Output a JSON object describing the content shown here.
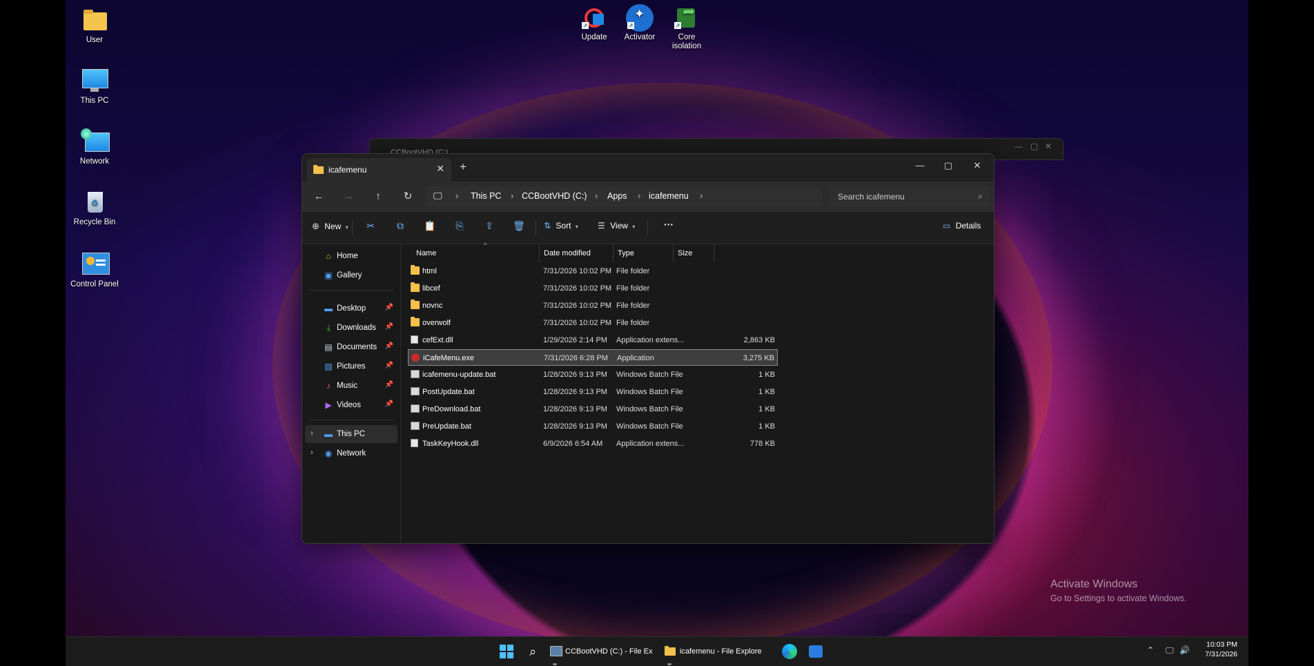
{
  "desktop": {
    "icons": [
      {
        "label": "User"
      },
      {
        "label": "This PC"
      },
      {
        "label": "Network"
      },
      {
        "label": "Recycle Bin"
      },
      {
        "label": "Control Panel"
      },
      {
        "label": "Update"
      },
      {
        "label": "Activator"
      },
      {
        "label": "Core isolation"
      }
    ]
  },
  "back_window": {
    "tab_label": "CCBootVHD (C:)"
  },
  "window": {
    "tab_label": "icafemenu",
    "address": [
      "This PC",
      "CCBootVHD (C:)",
      "Apps",
      "icafemenu"
    ],
    "search_placeholder": "Search icafemenu",
    "toolbar": {
      "new": "New",
      "sort": "Sort",
      "view": "View",
      "more": "···",
      "details": "Details"
    },
    "sidebar": {
      "quick": [
        {
          "label": "Home"
        },
        {
          "label": "Gallery"
        }
      ],
      "pinned": [
        {
          "label": "Desktop"
        },
        {
          "label": "Downloads"
        },
        {
          "label": "Documents"
        },
        {
          "label": "Pictures"
        },
        {
          "label": "Music"
        },
        {
          "label": "Videos"
        }
      ],
      "tree": [
        {
          "label": "This PC"
        },
        {
          "label": "Network"
        }
      ]
    },
    "columns": {
      "name": "Name",
      "date": "Date modified",
      "type": "Type",
      "size": "Size"
    },
    "files": [
      {
        "name": "html",
        "date": "7/31/2026 10:02 PM",
        "type": "File folder",
        "size": "",
        "icon": "folder"
      },
      {
        "name": "libcef",
        "date": "7/31/2026 10:02 PM",
        "type": "File folder",
        "size": "",
        "icon": "folder"
      },
      {
        "name": "novnc",
        "date": "7/31/2026 10:02 PM",
        "type": "File folder",
        "size": "",
        "icon": "folder"
      },
      {
        "name": "overwolf",
        "date": "7/31/2026 10:02 PM",
        "type": "File folder",
        "size": "",
        "icon": "folder"
      },
      {
        "name": "cefExt.dll",
        "date": "1/29/2026 2:14 PM",
        "type": "Application extens...",
        "size": "2,863 KB",
        "icon": "doc"
      },
      {
        "name": "iCafeMenu.exe",
        "date": "7/31/2026 6:28 PM",
        "type": "Application",
        "size": "3,275 KB",
        "icon": "exe"
      },
      {
        "name": "icafemenu-update.bat",
        "date": "1/28/2026 9:13 PM",
        "type": "Windows Batch File",
        "size": "1 KB",
        "icon": "bat"
      },
      {
        "name": "PostUpdate.bat",
        "date": "1/28/2026 9:13 PM",
        "type": "Windows Batch File",
        "size": "1 KB",
        "icon": "bat"
      },
      {
        "name": "PreDownload.bat",
        "date": "1/28/2026 9:13 PM",
        "type": "Windows Batch File",
        "size": "1 KB",
        "icon": "bat"
      },
      {
        "name": "PreUpdate.bat",
        "date": "1/28/2026 9:13 PM",
        "type": "Windows Batch File",
        "size": "1 KB",
        "icon": "bat"
      },
      {
        "name": "TaskKeyHook.dll",
        "date": "6/9/2026 6:54 AM",
        "type": "Application extens...",
        "size": "778 KB",
        "icon": "doc"
      }
    ]
  },
  "watermark": {
    "line1": "Activate Windows",
    "line2": "Go to Settings to activate Windows."
  },
  "taskbar": {
    "apps": [
      {
        "label": "CCBootVHD (C:) - File Ex"
      },
      {
        "label": "icafemenu - File Explore"
      }
    ],
    "clock": {
      "time": "10:03 PM",
      "date": "7/31/2026"
    }
  }
}
